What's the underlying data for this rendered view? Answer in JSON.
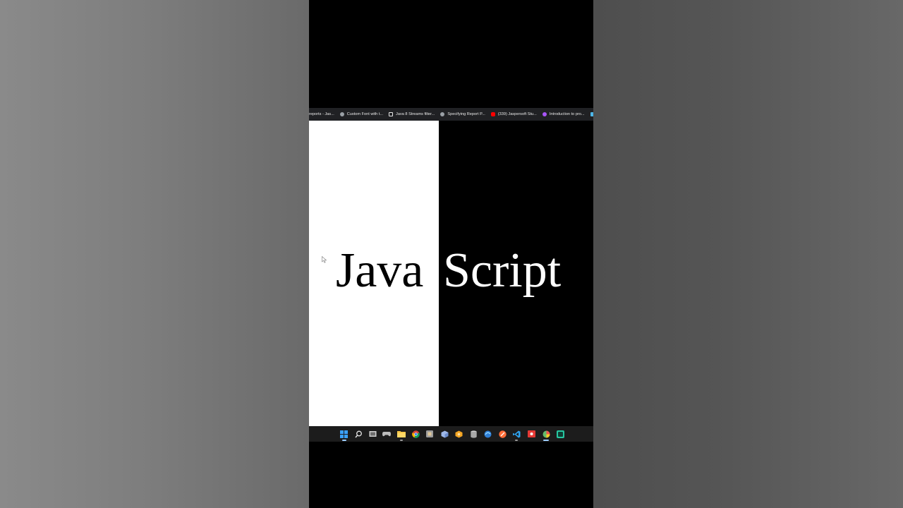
{
  "bookmarks": [
    {
      "label": "reports - Jas...",
      "icon": "none-icon",
      "color": "#202124"
    },
    {
      "label": "Custom Font with t...",
      "icon": "globe-icon",
      "color": "#9aa0a6"
    },
    {
      "label": "Java 8 Streams filter...",
      "icon": "stackoverflow-icon",
      "color": "#e8e8e8"
    },
    {
      "label": "Specifying Report P...",
      "icon": "globe-icon",
      "color": "#9aa0a6"
    },
    {
      "label": "(339) Jaspersoft Stu...",
      "icon": "youtube-icon",
      "color": "#ff0000"
    },
    {
      "label": "Introduction to pro...",
      "icon": "site-icon",
      "color": "#a855f7"
    }
  ],
  "screen": {
    "word_left": "Java",
    "word_right": "Script"
  },
  "colors": {
    "left_half": "#ffffff",
    "right_half": "#000000",
    "taskbar": "#1c1c1c",
    "bookmarks_bar": "#202124"
  },
  "taskbar_icons": [
    "windows-start-icon",
    "search-icon",
    "task-view-icon",
    "gamepad-icon",
    "file-explorer-icon",
    "chrome-icon",
    "app-icon",
    "cube-icon",
    "blender-icon",
    "database-icon",
    "browser-icon",
    "postman-icon",
    "vscode-icon",
    "red-app-icon",
    "photos-icon",
    "terminal-icon"
  ]
}
